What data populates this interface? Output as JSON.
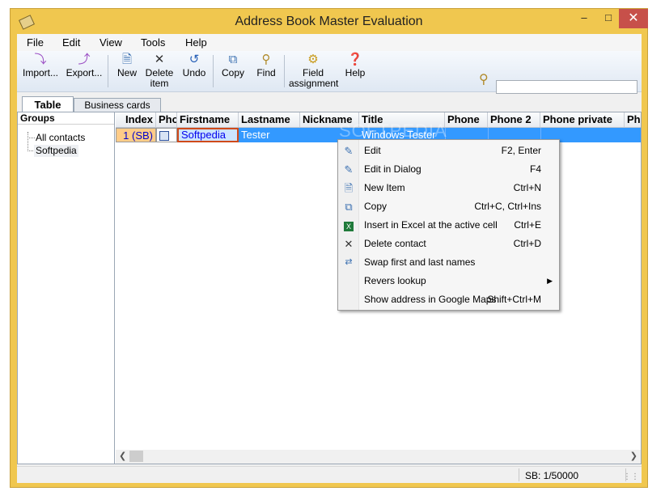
{
  "window": {
    "title": "Address Book Master Evaluation"
  },
  "menu": [
    "File",
    "Edit",
    "View",
    "Tools",
    "Help"
  ],
  "toolbar": {
    "import": "Import...",
    "export": "Export...",
    "new": "New",
    "delete_1": "Delete",
    "delete_2": "item",
    "undo": "Undo",
    "copy": "Copy",
    "find": "Find",
    "field_1": "Field",
    "field_2": "assignment",
    "help": "Help"
  },
  "search": {
    "value": ""
  },
  "tabs": {
    "table": "Table",
    "business_cards": "Business cards"
  },
  "groups": {
    "header": "Groups",
    "items": [
      "All contacts",
      "Softpedia"
    ]
  },
  "grid": {
    "columns": [
      "Index",
      "Pho",
      "Firstname",
      "Lastname",
      "Nickname",
      "Title",
      "Phone",
      "Phone 2",
      "Phone private",
      "Pho"
    ],
    "row": {
      "index": "1 (SB)",
      "firstname": "Softpedia",
      "lastname": "Tester",
      "nickname": "",
      "title": "Windows Tester"
    },
    "watermark": "SOFTPEDIA"
  },
  "status": {
    "text": "SB: 1/50000"
  },
  "context_menu": [
    {
      "label": "Edit",
      "shortcut": "F2, Enter",
      "icon": "edit-icon"
    },
    {
      "label": "Edit in Dialog",
      "shortcut": "F4",
      "icon": "edit-dialog-icon"
    },
    {
      "label": "New Item",
      "shortcut": "Ctrl+N",
      "icon": "new-item-icon"
    },
    {
      "label": "Copy",
      "shortcut": "Ctrl+C, Ctrl+Ins",
      "icon": "copy-icon"
    },
    {
      "label": "Insert in Excel at the active cell",
      "shortcut": "Ctrl+E",
      "icon": "excel-icon"
    },
    {
      "label": "Delete contact",
      "shortcut": "Ctrl+D",
      "icon": "delete-icon"
    },
    {
      "label": "Swap first and last names",
      "shortcut": "",
      "icon": "swap-icon"
    },
    {
      "label": "Revers lookup",
      "shortcut": "",
      "icon": ""
    },
    {
      "label": "Show address in Google Maps",
      "shortcut": "Shift+Ctrl+M",
      "icon": ""
    }
  ],
  "colors": {
    "selection": "#3399ff",
    "frame": "#f0c74f",
    "close": "#c7504a"
  }
}
